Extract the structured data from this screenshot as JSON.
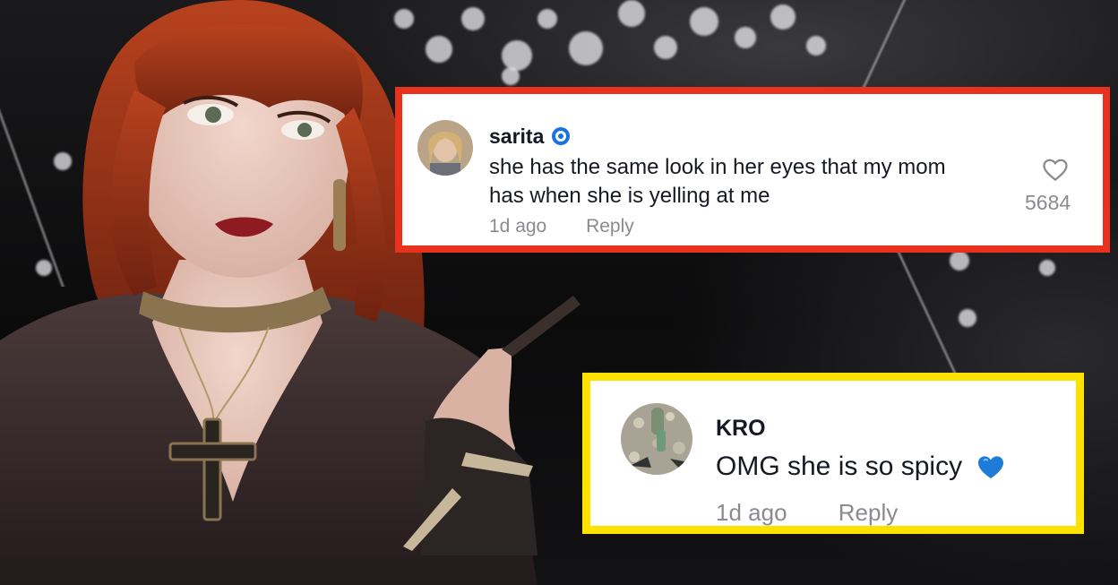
{
  "comments": [
    {
      "username": "sarita",
      "verified": true,
      "text_line1": "she has the same look in her eyes that my mom",
      "text_line2": "has when she is yelling at me",
      "time": "1d ago",
      "reply_label": "Reply",
      "likes": "5684",
      "highlight_color": "#e8321e"
    },
    {
      "username": "KRO",
      "text": "OMG she is so spicy",
      "emoji": "blue-heart-icon",
      "time": "1d ago",
      "reply_label": "Reply",
      "highlight_color": "#fde200"
    }
  ]
}
